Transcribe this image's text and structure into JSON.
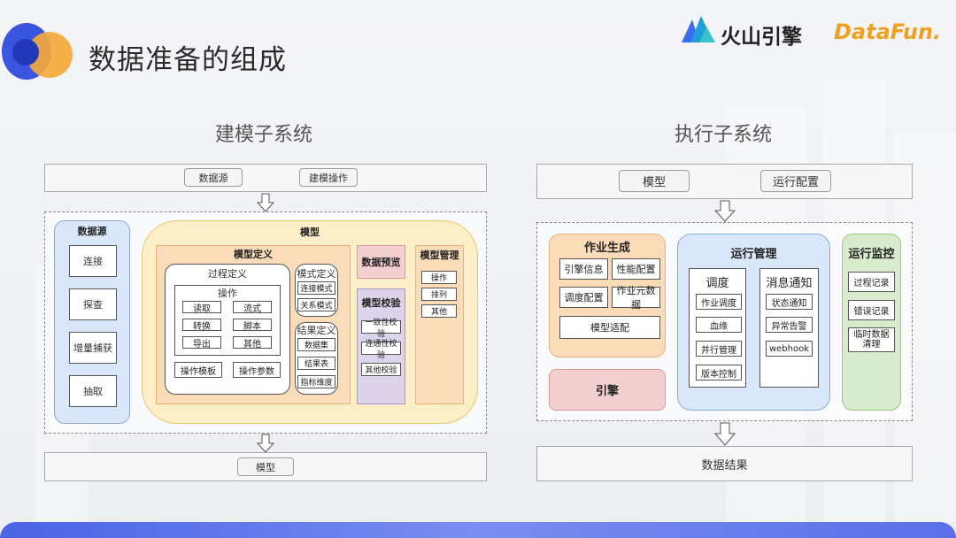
{
  "slide": {
    "title": "数据准备的组成",
    "brand_volcano": "火山引擎",
    "brand_datafun": "DataFun."
  },
  "colors": {
    "accent_blue": "#3a55e0",
    "accent_orange": "#f5a93b",
    "panel_blue": "#dae6f9",
    "panel_yellow": "#fcefc7",
    "panel_green": "#d8ebcd",
    "panel_purple": "#ddd3ea",
    "panel_pink": "#f3cfcf"
  },
  "icons": [
    "arrow-down-icon"
  ],
  "modeling": {
    "title": "建模子系统",
    "top_inputs": [
      "数据源",
      "建模操作"
    ],
    "datasource": {
      "title": "数据源",
      "items": [
        "连接",
        "探查",
        "增量捕获",
        "抽取"
      ]
    },
    "model": {
      "title": "模型",
      "definition": {
        "title": "模型定义",
        "process": {
          "title": "过程定义",
          "operation": {
            "title": "操作",
            "cells": [
              "读取",
              "流式",
              "转换",
              "脚本",
              "导出",
              "其他"
            ]
          },
          "bottom_cells": [
            "操作模板",
            "操作参数"
          ]
        },
        "schema": {
          "title": "模式定义",
          "cells": [
            "连接模式",
            "关系模式"
          ]
        },
        "result": {
          "title": "结果定义",
          "cells": [
            "数据集",
            "结果表",
            "指标维度"
          ]
        }
      },
      "preview": "数据预览",
      "validation": {
        "title": "模型校验",
        "cells": [
          "一致性校验",
          "连通性校验",
          "其他校验"
        ]
      },
      "management": {
        "title": "模型管理",
        "cells": [
          "操作",
          "排列",
          "其他"
        ]
      }
    },
    "output": "模型"
  },
  "execution": {
    "title": "执行子系统",
    "top_inputs": [
      "模型",
      "运行配置"
    ],
    "job_gen": {
      "title": "作业生成",
      "cells": [
        "引擎信息",
        "性能配置",
        "调度配置",
        "作业元数据"
      ],
      "wide_cell": "模型适配"
    },
    "engine": "引擎",
    "run_mgmt": {
      "title": "运行管理",
      "schedule": {
        "title": "调度",
        "cells": [
          "作业调度",
          "血缘",
          "并行管理",
          "版本控制"
        ]
      },
      "notify": {
        "title": "消息通知",
        "cells": [
          "状态通知",
          "异常告警",
          "webhook"
        ]
      }
    },
    "monitor": {
      "title": "运行监控",
      "cells": [
        "过程记录",
        "错误记录",
        "临时数据\n清理"
      ]
    },
    "output": "数据结果"
  }
}
